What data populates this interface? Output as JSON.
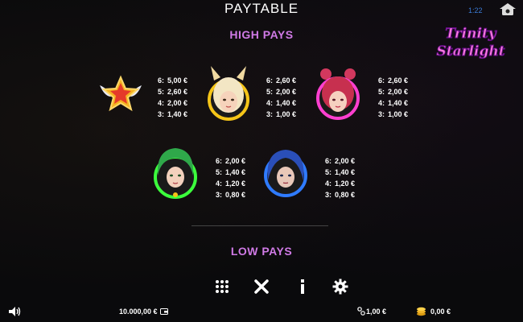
{
  "header": {
    "title": "PAYTABLE",
    "clock": "1:22"
  },
  "logo": {
    "line1": "Trinity",
    "line2": "Starlight"
  },
  "sections": {
    "high_pays": "HIGH PAYS",
    "low_pays": "LOW PAYS"
  },
  "symbols": [
    {
      "name": "star",
      "pays": [
        {
          "count": "6:",
          "value": "5,00 €"
        },
        {
          "count": "5:",
          "value": "2,60 €"
        },
        {
          "count": "4:",
          "value": "2,00 €"
        },
        {
          "count": "3:",
          "value": "1,40 €"
        }
      ]
    },
    {
      "name": "blonde-girl",
      "pays": [
        {
          "count": "6:",
          "value": "2,60 €"
        },
        {
          "count": "5:",
          "value": "2,00 €"
        },
        {
          "count": "4:",
          "value": "1,40 €"
        },
        {
          "count": "3:",
          "value": "1,00 €"
        }
      ]
    },
    {
      "name": "pink-girl",
      "pays": [
        {
          "count": "6:",
          "value": "2,60 €"
        },
        {
          "count": "5:",
          "value": "2,00 €"
        },
        {
          "count": "4:",
          "value": "1,40 €"
        },
        {
          "count": "3:",
          "value": "1,00 €"
        }
      ]
    },
    {
      "name": "green-girl",
      "pays": [
        {
          "count": "6:",
          "value": "2,00 €"
        },
        {
          "count": "5:",
          "value": "1,40 €"
        },
        {
          "count": "4:",
          "value": "1,20 €"
        },
        {
          "count": "3:",
          "value": "0,80 €"
        }
      ]
    },
    {
      "name": "blue-girl",
      "pays": [
        {
          "count": "6:",
          "value": "2,00 €"
        },
        {
          "count": "5:",
          "value": "1,40 €"
        },
        {
          "count": "4:",
          "value": "1,20 €"
        },
        {
          "count": "3:",
          "value": "0,80 €"
        }
      ]
    }
  ],
  "footer": {
    "balance": "10.000,00 €",
    "bet": "1,00 €",
    "win": "0,00 €"
  },
  "colors": {
    "section": "#d07ae6",
    "gold": "#f5c518",
    "pink": "#ff3fd0",
    "green": "#3cff3c",
    "blue": "#2f7bff"
  },
  "icons": [
    "grid-menu-icon",
    "close-icon",
    "info-icon",
    "gear-icon",
    "speaker-icon",
    "wallet-icon",
    "coin-stack-icon",
    "bet-link-icon",
    "home-icon"
  ]
}
